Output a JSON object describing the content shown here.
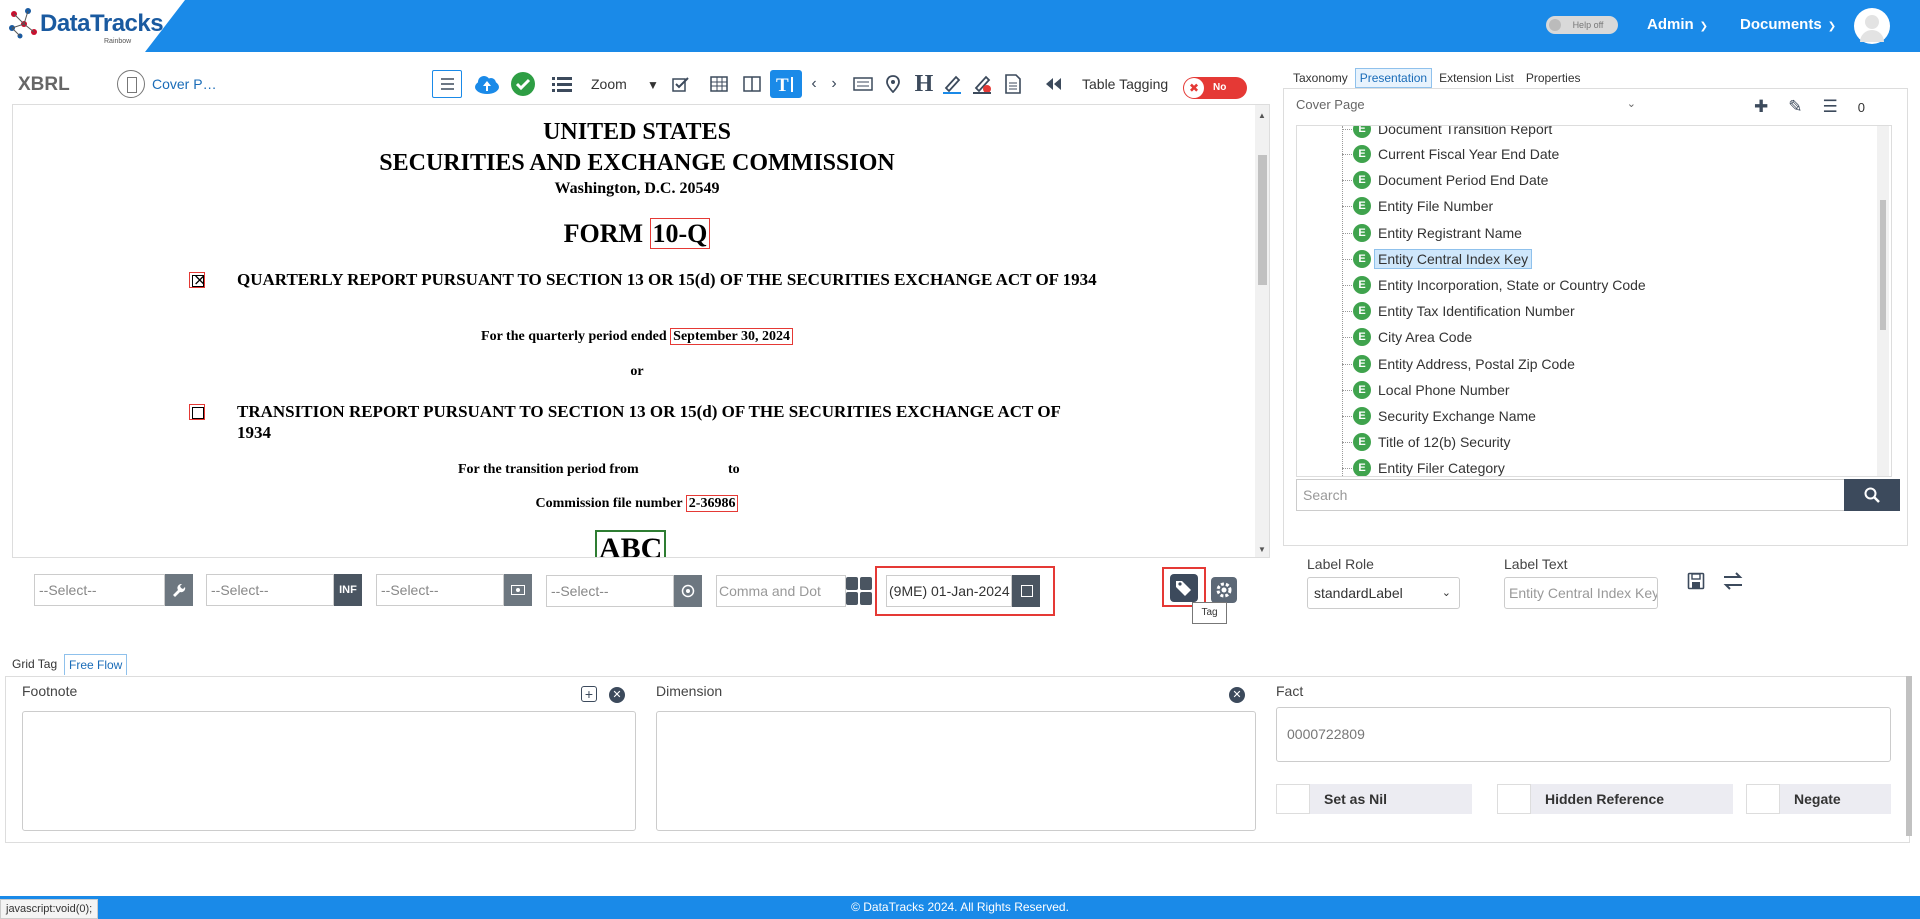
{
  "header": {
    "logo_text": "DataTracks",
    "logo_sub": "Rainbow",
    "help_toggle": "Help off",
    "menu_admin": "Admin",
    "menu_documents": "Documents"
  },
  "toolbar": {
    "xbrl": "XBRL",
    "cover_name": "Cover P…",
    "zoom": "Zoom",
    "table_tagging": "Table Tagging",
    "table_tagging_state": "No"
  },
  "document": {
    "line1": "UNITED STATES",
    "line2": "SECURITIES AND EXCHANGE COMMISSION",
    "line3": "Washington, D.C. 20549",
    "form_prefix": "FORM",
    "form_type": "10-Q",
    "quarterly_text": "QUARTERLY REPORT PURSUANT TO SECTION 13 OR 15(d) OF THE SECURITIES EXCHANGE ACT OF 1934",
    "period_prefix": "For the quarterly period ended",
    "period_value": "September 30, 2024",
    "or": "or",
    "transition_text": "TRANSITION REPORT PURSUANT TO SECTION 13 OR 15(d) OF THE SECURITIES EXCHANGE ACT OF 1934",
    "transition_from": "For the transition period from",
    "transition_to": "to",
    "commission_prefix": "Commission file number",
    "commission_value": "2-36986",
    "logo_partial": "ABC"
  },
  "controls": {
    "select1": "--Select--",
    "select2": "--Select--",
    "select3": "--Select--",
    "select4": "--Select--",
    "inf_label": "INF",
    "format_placeholder": "Comma and Dot",
    "period": "(9ME) 01-Jan-2024",
    "tag_tooltip": "Tag"
  },
  "right_panel": {
    "tabs": [
      "Taxonomy",
      "Presentation",
      "Extension List",
      "Properties"
    ],
    "active_tab": "Presentation",
    "section_select": "Cover Page",
    "count": "0",
    "tree_items": [
      "Document Transition Report",
      "Current Fiscal Year End Date",
      "Document Period End Date",
      "Entity File Number",
      "Entity Registrant Name",
      "Entity Central Index Key",
      "Entity Incorporation, State or Country Code",
      "Entity Tax Identification Number",
      "City Area Code",
      "Entity Address, Postal Zip Code",
      "Local Phone Number",
      "Security Exchange Name",
      "Title of 12(b) Security",
      "Entity Filer Category"
    ],
    "selected_item": "Entity Central Index Key",
    "search_placeholder": "Search",
    "label_role_title": "Label Role",
    "label_role_value": "standardLabel",
    "label_text_title": "Label Text",
    "label_text_value": "Entity Central Index Key"
  },
  "bottom": {
    "tab_grid": "Grid Tag",
    "tab_free": "Free Flow",
    "footnote": "Footnote",
    "dimension": "Dimension",
    "fact": "Fact",
    "fact_value": "0000722809",
    "set_nil": "Set as Nil",
    "hidden_ref": "Hidden Reference",
    "negate": "Negate"
  },
  "footer": {
    "copyright": "© DataTracks 2024. All Rights Reserved.",
    "status": "javascript:void(0);"
  },
  "colors": {
    "brand_blue": "#1a8ae8",
    "tag_red": "#e53935",
    "element_green": "#3fa34d",
    "dark_button": "#3c4a5c"
  }
}
